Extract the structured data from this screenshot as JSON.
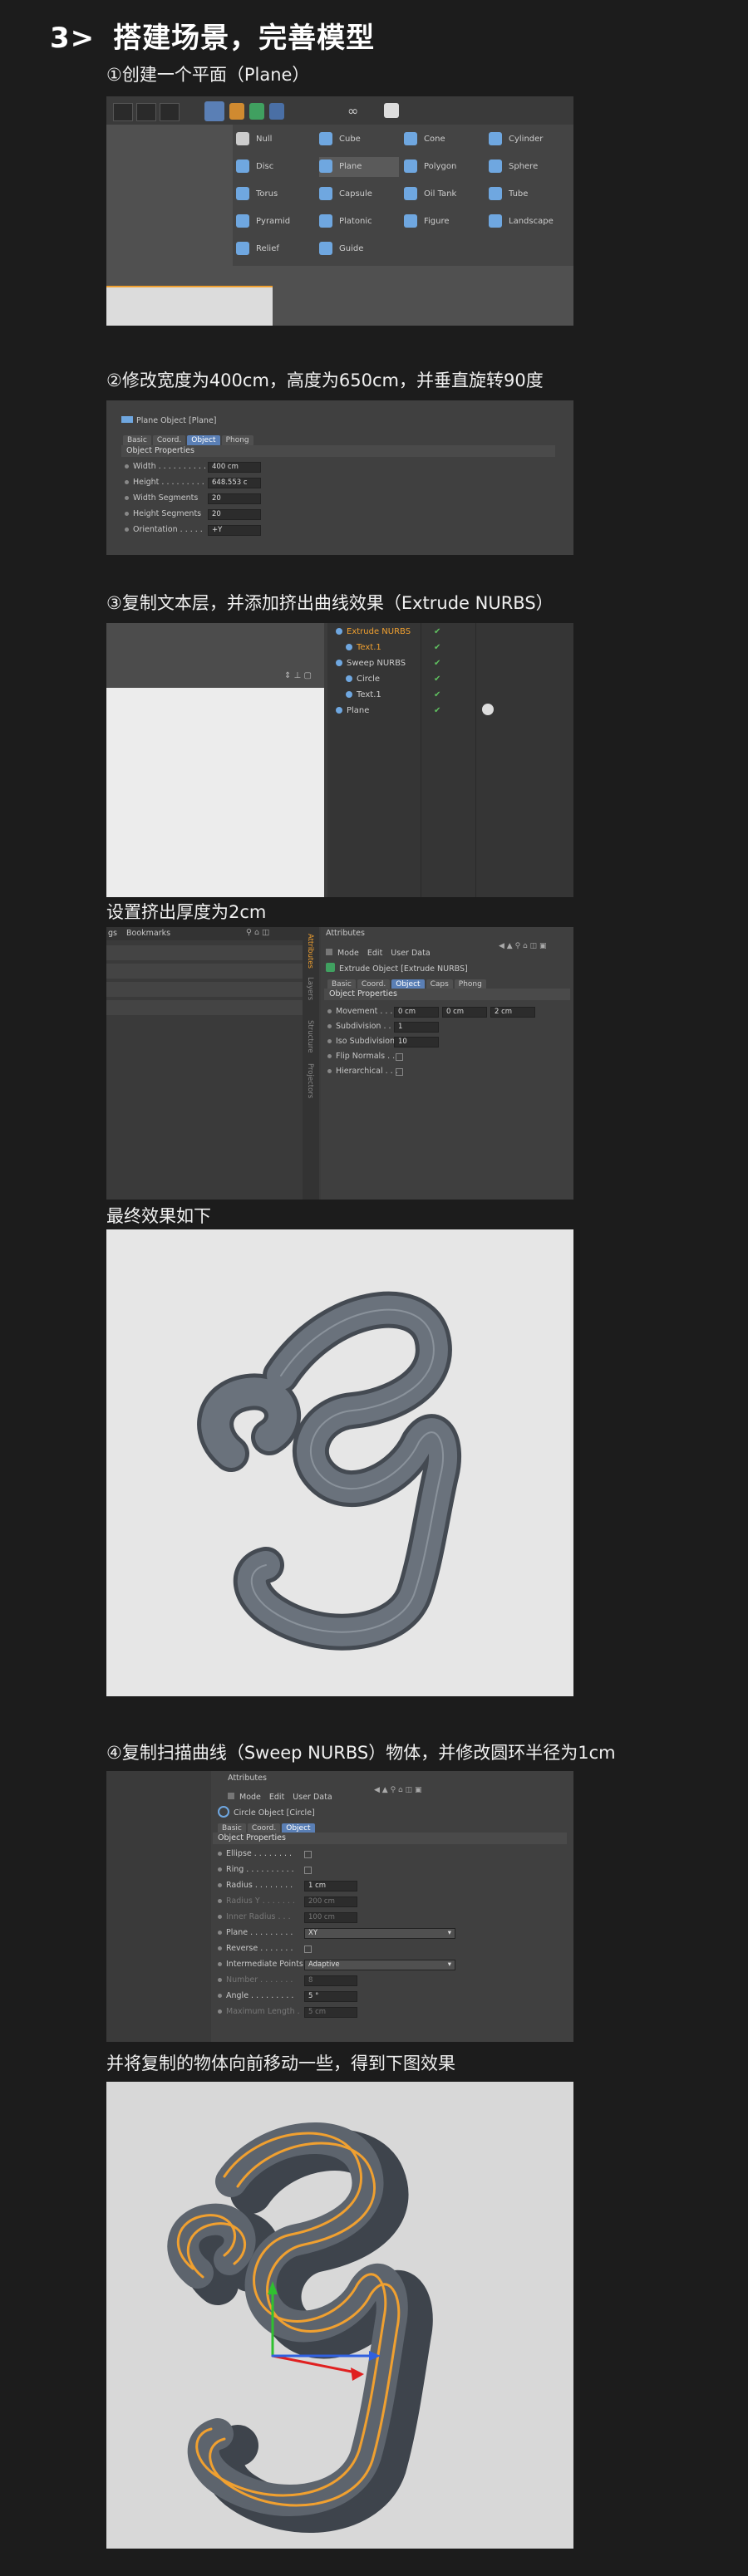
{
  "header": {
    "num": "3>",
    "title": "搭建场景，完善模型"
  },
  "step1": {
    "caption": "①创建一个平面（Plane）",
    "menu": [
      {
        "label": "Null",
        "col": 0,
        "row": 0,
        "color": "#cccccc"
      },
      {
        "label": "Disc",
        "col": 0,
        "row": 1,
        "color": "#6fa7e0"
      },
      {
        "label": "Torus",
        "col": 0,
        "row": 2,
        "color": "#6fa7e0"
      },
      {
        "label": "Pyramid",
        "col": 0,
        "row": 3,
        "color": "#6fa7e0"
      },
      {
        "label": "Relief",
        "col": 0,
        "row": 4,
        "color": "#6fa7e0"
      },
      {
        "label": "Cube",
        "col": 1,
        "row": 0,
        "color": "#6fa7e0"
      },
      {
        "label": "Plane",
        "col": 1,
        "row": 1,
        "color": "#6fa7e0"
      },
      {
        "label": "Capsule",
        "col": 1,
        "row": 2,
        "color": "#6fa7e0"
      },
      {
        "label": "Platonic",
        "col": 1,
        "row": 3,
        "color": "#6fa7e0"
      },
      {
        "label": "Guide",
        "col": 1,
        "row": 4,
        "color": "#6fa7e0"
      },
      {
        "label": "Cone",
        "col": 2,
        "row": 0,
        "color": "#6fa7e0"
      },
      {
        "label": "Polygon",
        "col": 2,
        "row": 1,
        "color": "#6fa7e0"
      },
      {
        "label": "Oil Tank",
        "col": 2,
        "row": 2,
        "color": "#6fa7e0"
      },
      {
        "label": "Figure",
        "col": 2,
        "row": 3,
        "color": "#6fa7e0"
      },
      {
        "label": "Cylinder",
        "col": 3,
        "row": 0,
        "color": "#6fa7e0"
      },
      {
        "label": "Sphere",
        "col": 3,
        "row": 1,
        "color": "#6fa7e0"
      },
      {
        "label": "Tube",
        "col": 3,
        "row": 2,
        "color": "#6fa7e0"
      },
      {
        "label": "Landscape",
        "col": 3,
        "row": 3,
        "color": "#6fa7e0"
      }
    ]
  },
  "step2": {
    "caption": "②修改宽度为400cm，高度为650cm，并垂直旋转90度",
    "title": "Plane Object [Plane]",
    "tabs": [
      "Basic",
      "Coord.",
      "Object",
      "Phong"
    ],
    "active_tab": "Object",
    "section": "Object Properties",
    "rows": [
      {
        "label": "Width . . . . . . . . . .",
        "value": "400 cm"
      },
      {
        "label": "Height . . . . . . . . .",
        "value": "648.553 c"
      },
      {
        "label": "Width Segments",
        "value": "20"
      },
      {
        "label": "Height Segments",
        "value": "20"
      },
      {
        "label": "Orientation . . . . .",
        "value": "+Y"
      }
    ]
  },
  "step3": {
    "caption": "③复制文本层，并添加挤出曲线效果（Extrude NURBS）",
    "tree": [
      {
        "label": "Extrude NURBS",
        "indent": 0,
        "color": "#f0a030"
      },
      {
        "label": "Text.1",
        "indent": 1,
        "color": "#f0a030"
      },
      {
        "label": "Sweep NURBS",
        "indent": 0,
        "color": "#cccccc"
      },
      {
        "label": "Circle",
        "indent": 1,
        "color": "#cccccc"
      },
      {
        "label": "Text.1",
        "indent": 1,
        "color": "#cccccc"
      },
      {
        "label": "Plane",
        "indent": 0,
        "color": "#cccccc"
      }
    ]
  },
  "step3b": {
    "caption": "设置挤出厚度为2cm",
    "left_menu": [
      "gs",
      "Bookmarks"
    ],
    "attr_title": "Attributes",
    "attr_menu": [
      "Mode",
      "Edit",
      "User Data"
    ],
    "object_title": "Extrude Object [Extrude NURBS]",
    "tabs": [
      "Basic",
      "Coord.",
      "Object",
      "Caps",
      "Phong"
    ],
    "active_tab": "Object",
    "section": "Object Properties",
    "side_tabs": [
      "Attributes",
      "Layers",
      "Structure",
      "Projectors"
    ],
    "rows": [
      {
        "label": "Movement . . . .",
        "values": [
          "0 cm",
          "0 cm",
          "2 cm"
        ]
      },
      {
        "label": "Subdivision . . .",
        "values": [
          "1"
        ]
      },
      {
        "label": "Iso Subdivision",
        "values": [
          "10"
        ]
      },
      {
        "label": "Flip Normals . .",
        "values": []
      },
      {
        "label": "Hierarchical . . .",
        "values": []
      }
    ]
  },
  "result1": {
    "caption": "最终效果如下"
  },
  "step4": {
    "caption": "④复制扫描曲线（Sweep NURBS）物体，并修改圆环半径为1cm",
    "attr_title": "Attributes",
    "attr_menu": [
      "Mode",
      "Edit",
      "User Data"
    ],
    "object_title": "Circle Object [Circle]",
    "tabs": [
      "Basic",
      "Coord.",
      "Object"
    ],
    "active_tab": "Object",
    "section": "Object Properties",
    "rows": [
      {
        "label": "Ellipse . . . . . . . .",
        "value": "",
        "kind": "check"
      },
      {
        "label": "Ring . . . . . . . . . .",
        "value": "",
        "kind": "check"
      },
      {
        "label": "Radius . . . . . . . .",
        "value": "1 cm",
        "kind": "field"
      },
      {
        "label": "Radius Y . . . . . . .",
        "value": "200 cm",
        "kind": "field",
        "dim": true
      },
      {
        "label": "Inner Radius . . .",
        "value": "100 cm",
        "kind": "field",
        "dim": true
      },
      {
        "label": "Plane . . . . . . . . .",
        "value": "XY",
        "kind": "select"
      },
      {
        "label": "Reverse . . . . . . .",
        "value": "",
        "kind": "check"
      },
      {
        "label": "Intermediate Points",
        "value": "Adaptive",
        "kind": "select"
      },
      {
        "label": "Number . . . . . . .",
        "value": "8",
        "kind": "field",
        "dim": true
      },
      {
        "label": "Angle . . . . . . . . .",
        "value": "5 °",
        "kind": "field"
      },
      {
        "label": "Maximum Length .",
        "value": "5 cm",
        "kind": "field",
        "dim": true
      }
    ]
  },
  "result2": {
    "caption": "并将复制的物体向前移动一些，得到下图效果"
  },
  "colors": {
    "bg": "#1c1c1c",
    "panel": "#3d3d3d",
    "accent": "#5a7fb5",
    "orange": "#f0a030"
  }
}
